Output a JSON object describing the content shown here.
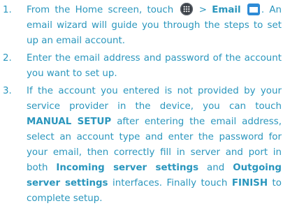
{
  "steps": [
    {
      "number": "1.",
      "t1": "From the Home screen, touch ",
      "t2": " > ",
      "b1": "Email",
      "t3": ". An email wizard will guide you through the steps to set up an email account.",
      "icons": [
        "apps-icon",
        "email-app-icon"
      ]
    },
    {
      "number": "2.",
      "t1": "Enter the email address and password of the account you want to set up."
    },
    {
      "number": "3.",
      "t1": "If the account you entered is not provided by your service provider in the device, you can touch ",
      "b1": "MANUAL SETUP",
      "t2": " after entering the email address, select an account type and enter the password for your email, then correctly fill in server and port in both ",
      "b2": "Incoming server settings",
      "t3": " and ",
      "b3": "Outgoing server settings",
      "t4": " interfaces. Finally touch ",
      "b4": "FINISH",
      "t5": " to complete setup."
    }
  ],
  "colors": {
    "text": "#2a96bd",
    "apps_icon_bg": "#3a3f46",
    "email_icon_bg": "#2e8bd6"
  }
}
